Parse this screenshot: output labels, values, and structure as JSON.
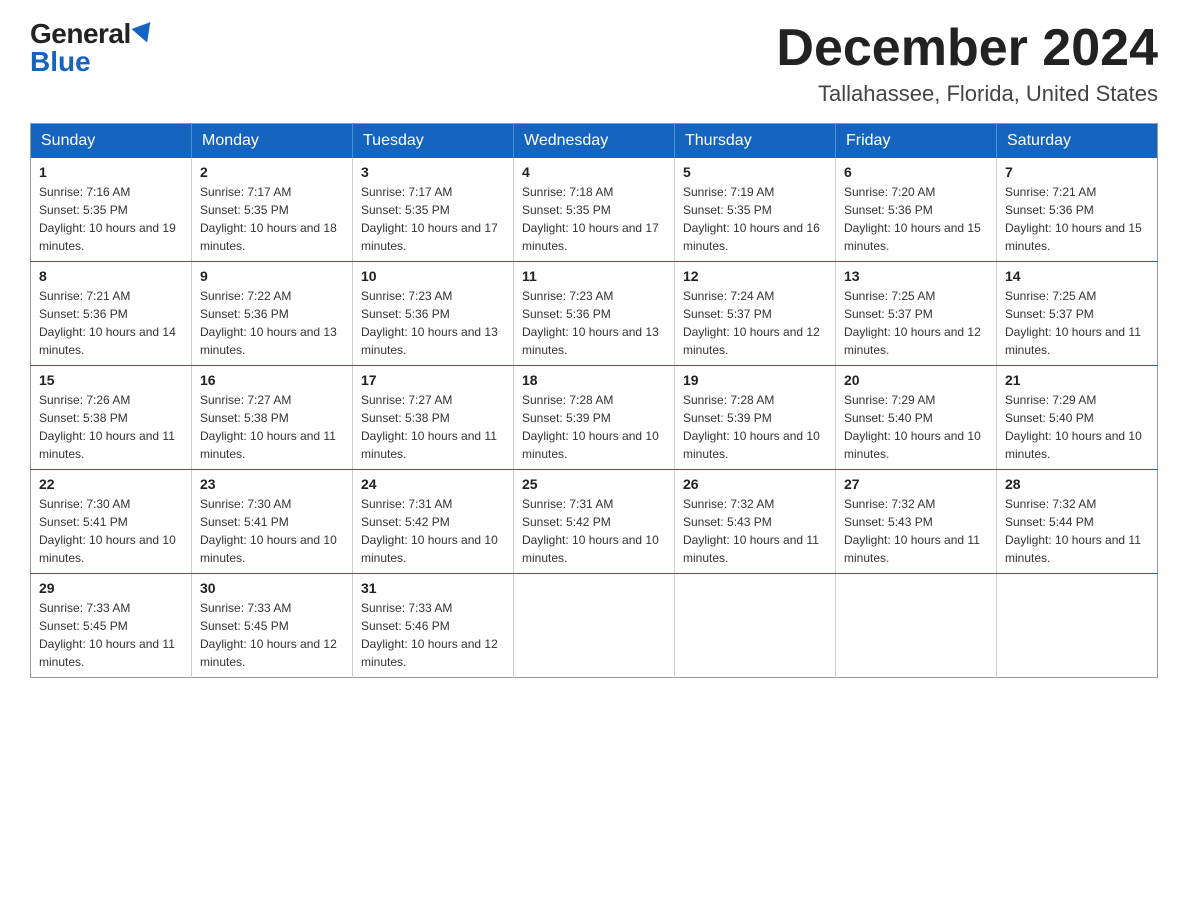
{
  "logo": {
    "general": "General",
    "blue": "Blue"
  },
  "title": "December 2024",
  "subtitle": "Tallahassee, Florida, United States",
  "days_of_week": [
    "Sunday",
    "Monday",
    "Tuesday",
    "Wednesday",
    "Thursday",
    "Friday",
    "Saturday"
  ],
  "weeks": [
    [
      {
        "day": 1,
        "sunrise": "7:16 AM",
        "sunset": "5:35 PM",
        "daylight": "10 hours and 19 minutes."
      },
      {
        "day": 2,
        "sunrise": "7:17 AM",
        "sunset": "5:35 PM",
        "daylight": "10 hours and 18 minutes."
      },
      {
        "day": 3,
        "sunrise": "7:17 AM",
        "sunset": "5:35 PM",
        "daylight": "10 hours and 17 minutes."
      },
      {
        "day": 4,
        "sunrise": "7:18 AM",
        "sunset": "5:35 PM",
        "daylight": "10 hours and 17 minutes."
      },
      {
        "day": 5,
        "sunrise": "7:19 AM",
        "sunset": "5:35 PM",
        "daylight": "10 hours and 16 minutes."
      },
      {
        "day": 6,
        "sunrise": "7:20 AM",
        "sunset": "5:36 PM",
        "daylight": "10 hours and 15 minutes."
      },
      {
        "day": 7,
        "sunrise": "7:21 AM",
        "sunset": "5:36 PM",
        "daylight": "10 hours and 15 minutes."
      }
    ],
    [
      {
        "day": 8,
        "sunrise": "7:21 AM",
        "sunset": "5:36 PM",
        "daylight": "10 hours and 14 minutes."
      },
      {
        "day": 9,
        "sunrise": "7:22 AM",
        "sunset": "5:36 PM",
        "daylight": "10 hours and 13 minutes."
      },
      {
        "day": 10,
        "sunrise": "7:23 AM",
        "sunset": "5:36 PM",
        "daylight": "10 hours and 13 minutes."
      },
      {
        "day": 11,
        "sunrise": "7:23 AM",
        "sunset": "5:36 PM",
        "daylight": "10 hours and 13 minutes."
      },
      {
        "day": 12,
        "sunrise": "7:24 AM",
        "sunset": "5:37 PM",
        "daylight": "10 hours and 12 minutes."
      },
      {
        "day": 13,
        "sunrise": "7:25 AM",
        "sunset": "5:37 PM",
        "daylight": "10 hours and 12 minutes."
      },
      {
        "day": 14,
        "sunrise": "7:25 AM",
        "sunset": "5:37 PM",
        "daylight": "10 hours and 11 minutes."
      }
    ],
    [
      {
        "day": 15,
        "sunrise": "7:26 AM",
        "sunset": "5:38 PM",
        "daylight": "10 hours and 11 minutes."
      },
      {
        "day": 16,
        "sunrise": "7:27 AM",
        "sunset": "5:38 PM",
        "daylight": "10 hours and 11 minutes."
      },
      {
        "day": 17,
        "sunrise": "7:27 AM",
        "sunset": "5:38 PM",
        "daylight": "10 hours and 11 minutes."
      },
      {
        "day": 18,
        "sunrise": "7:28 AM",
        "sunset": "5:39 PM",
        "daylight": "10 hours and 10 minutes."
      },
      {
        "day": 19,
        "sunrise": "7:28 AM",
        "sunset": "5:39 PM",
        "daylight": "10 hours and 10 minutes."
      },
      {
        "day": 20,
        "sunrise": "7:29 AM",
        "sunset": "5:40 PM",
        "daylight": "10 hours and 10 minutes."
      },
      {
        "day": 21,
        "sunrise": "7:29 AM",
        "sunset": "5:40 PM",
        "daylight": "10 hours and 10 minutes."
      }
    ],
    [
      {
        "day": 22,
        "sunrise": "7:30 AM",
        "sunset": "5:41 PM",
        "daylight": "10 hours and 10 minutes."
      },
      {
        "day": 23,
        "sunrise": "7:30 AM",
        "sunset": "5:41 PM",
        "daylight": "10 hours and 10 minutes."
      },
      {
        "day": 24,
        "sunrise": "7:31 AM",
        "sunset": "5:42 PM",
        "daylight": "10 hours and 10 minutes."
      },
      {
        "day": 25,
        "sunrise": "7:31 AM",
        "sunset": "5:42 PM",
        "daylight": "10 hours and 10 minutes."
      },
      {
        "day": 26,
        "sunrise": "7:32 AM",
        "sunset": "5:43 PM",
        "daylight": "10 hours and 11 minutes."
      },
      {
        "day": 27,
        "sunrise": "7:32 AM",
        "sunset": "5:43 PM",
        "daylight": "10 hours and 11 minutes."
      },
      {
        "day": 28,
        "sunrise": "7:32 AM",
        "sunset": "5:44 PM",
        "daylight": "10 hours and 11 minutes."
      }
    ],
    [
      {
        "day": 29,
        "sunrise": "7:33 AM",
        "sunset": "5:45 PM",
        "daylight": "10 hours and 11 minutes."
      },
      {
        "day": 30,
        "sunrise": "7:33 AM",
        "sunset": "5:45 PM",
        "daylight": "10 hours and 12 minutes."
      },
      {
        "day": 31,
        "sunrise": "7:33 AM",
        "sunset": "5:46 PM",
        "daylight": "10 hours and 12 minutes."
      },
      null,
      null,
      null,
      null
    ]
  ]
}
